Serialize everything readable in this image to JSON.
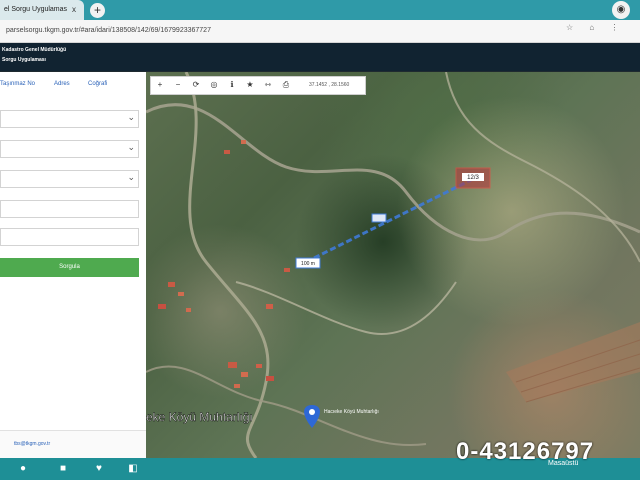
{
  "browser": {
    "tab_title": "el Sorgu Uygulamas",
    "tab_close": "x",
    "new_tab": "+",
    "profile_icon": "profile-icon",
    "url": "parselsorgu.tkgm.gov.tr/#ara/idari/138508/142/69/1679923367727"
  },
  "header": {
    "line1": "Kadastro Genel Müdürlüğü",
    "line2": "Sorgu Uygulaması"
  },
  "sidebar": {
    "tabs": [
      "Taşınmaz No",
      "Adres",
      "Coğrafi"
    ],
    "selects": [
      "",
      "",
      ""
    ],
    "inputs": [
      "",
      ""
    ],
    "query_button": "Sorgula",
    "email": "tbs@tkgm.gov.tr"
  },
  "map": {
    "tools": [
      "+",
      "−",
      "⟳",
      "◎",
      "ℹ",
      "★",
      "⇿",
      "⎙"
    ],
    "coord_text": "37.1452 , 28.1560",
    "aux": "",
    "marker_label_a": "12/3",
    "marker_label_b": "100 m",
    "place_label": "eke Köyü Muhtarlığı",
    "place_small": "Hacıeke Köyü Muhtarlığı"
  },
  "overlay_text": "0-43126797",
  "taskbar": {
    "clock": "Masaüstü",
    "apps": [
      "chrome-icon",
      "folder-icon",
      "app-icon",
      "media-icon"
    ]
  },
  "colors": {
    "tabbar": "#2f9aa8",
    "header": "#112331",
    "button": "#4faa4f",
    "route": "#3f7ad6"
  }
}
